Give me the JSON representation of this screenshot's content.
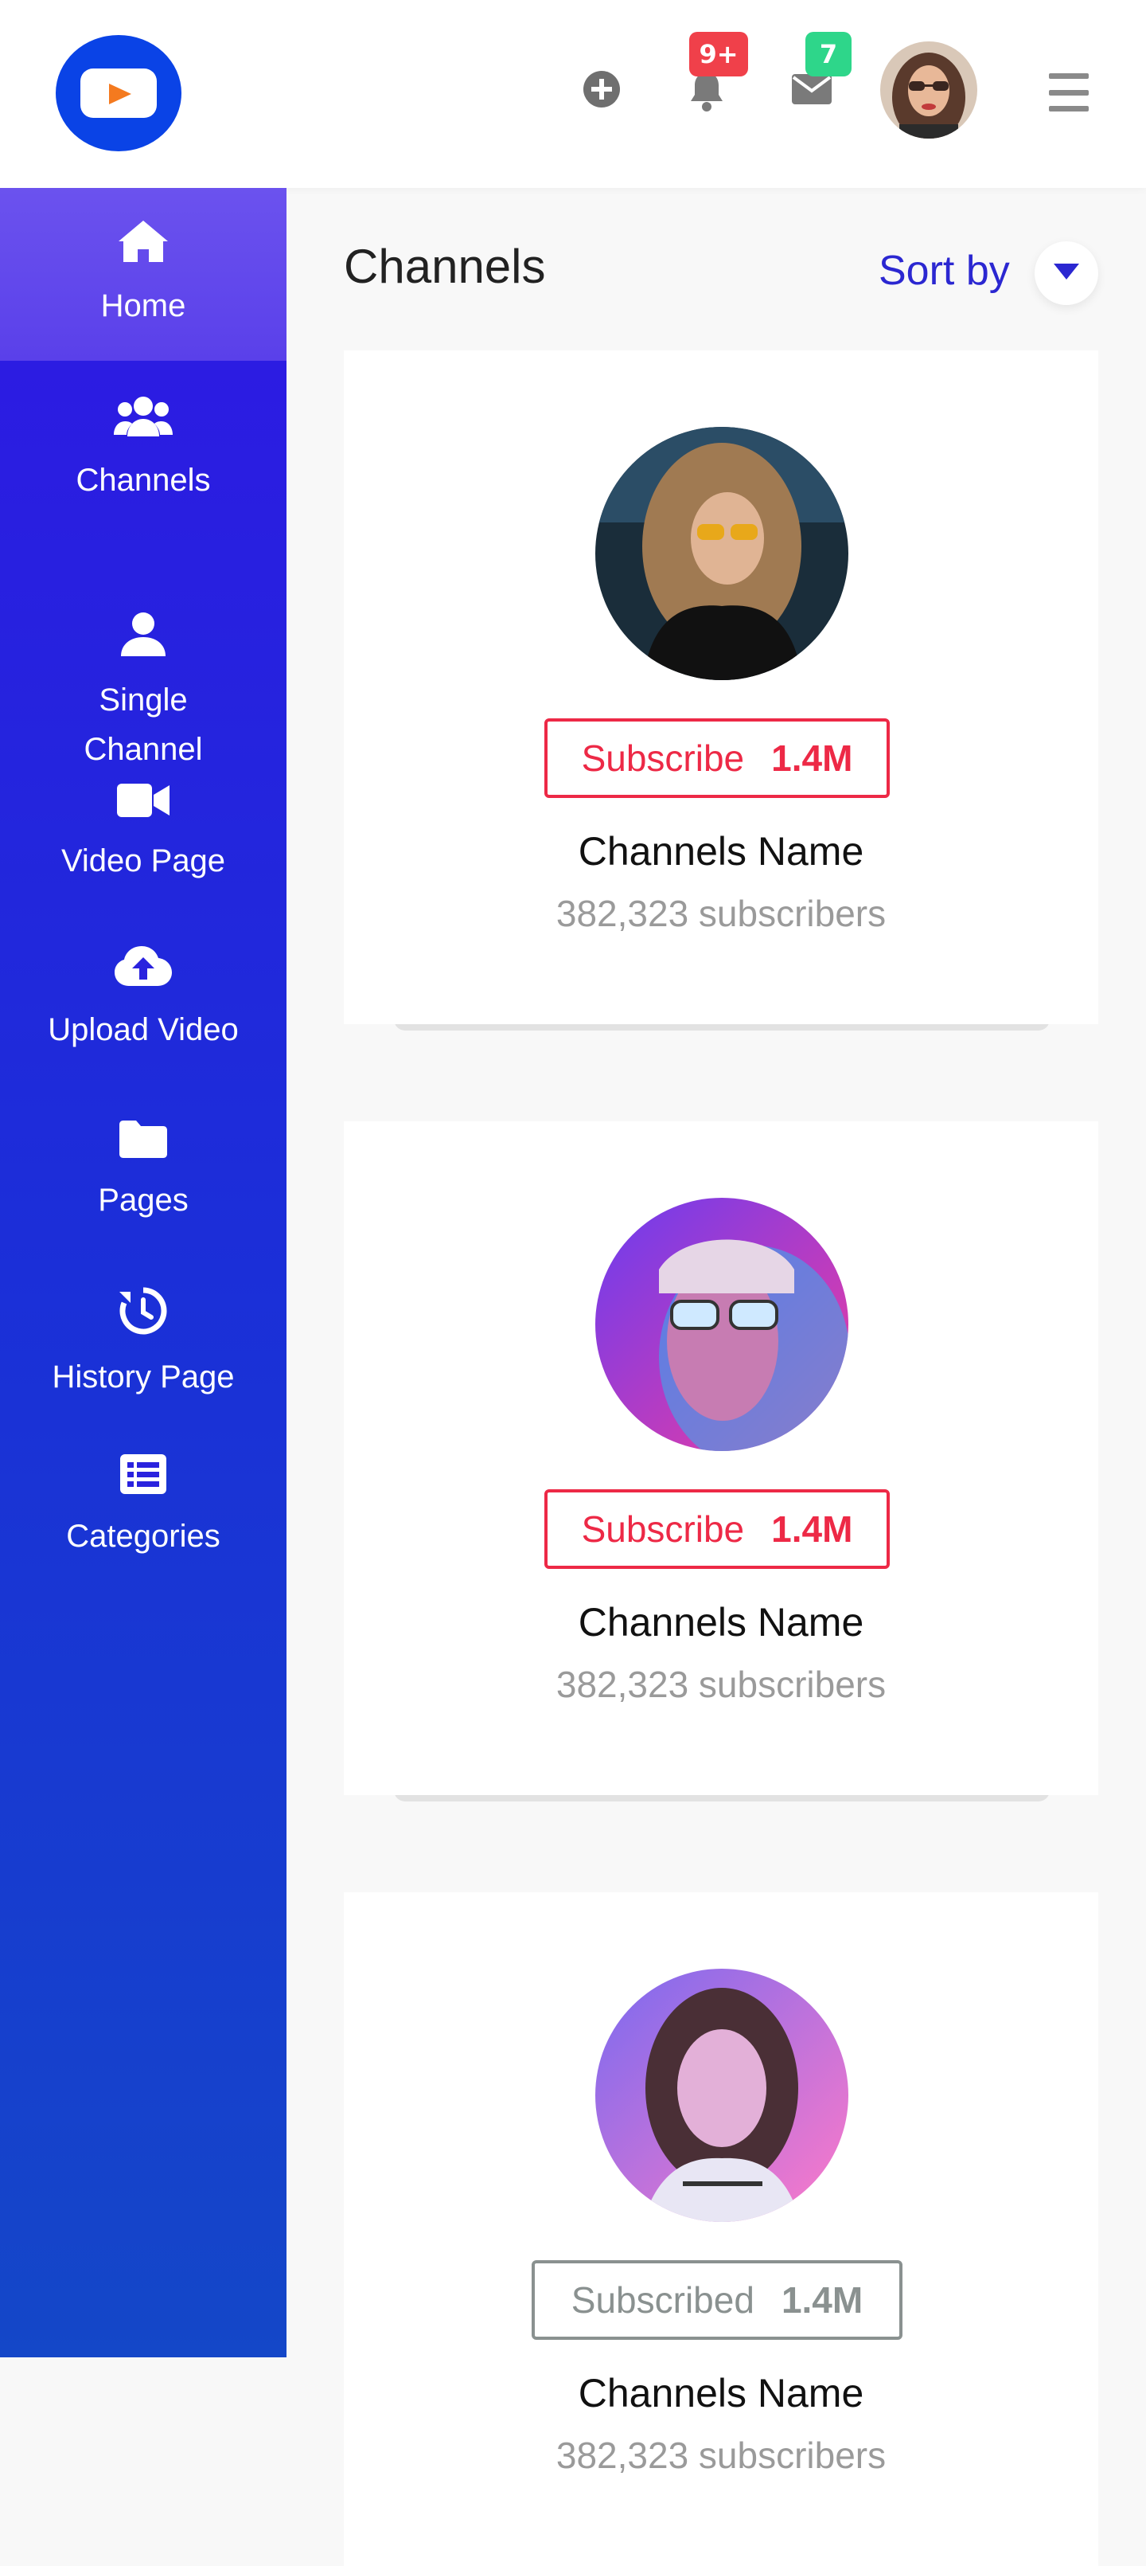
{
  "header": {
    "notifications_badge": "9+",
    "messages_badge": "7",
    "notifications_badge_color": "#f0404a",
    "messages_badge_color": "#2ed68a",
    "brand_color": "#0a43e6"
  },
  "sidebar": {
    "items": [
      {
        "label": "Home",
        "icon": "home-icon"
      },
      {
        "label": "Channels",
        "icon": "users-icon"
      },
      {
        "label": "Single\nChannel",
        "icon": "user-icon"
      },
      {
        "label": "Video Page",
        "icon": "video-camera-icon"
      },
      {
        "label": "Upload Video",
        "icon": "cloud-upload-icon"
      },
      {
        "label": "Pages",
        "icon": "folder-icon"
      },
      {
        "label": "History Page",
        "icon": "history-icon"
      },
      {
        "label": "Categories",
        "icon": "list-icon"
      }
    ]
  },
  "main": {
    "title": "Channels",
    "sort_label": "Sort by",
    "channels": [
      {
        "button_label": "Subscribe",
        "count": "1.4M",
        "name": "Channels Name",
        "subscribers": "382,323 subscribers",
        "subscribed": false
      },
      {
        "button_label": "Subscribe",
        "count": "1.4M",
        "name": "Channels Name",
        "subscribers": "382,323 subscribers",
        "subscribed": false
      },
      {
        "button_label": "Subscribed",
        "count": "1.4M",
        "name": "Channels Name",
        "subscribers": "382,323 subscribers",
        "subscribed": true
      }
    ]
  }
}
